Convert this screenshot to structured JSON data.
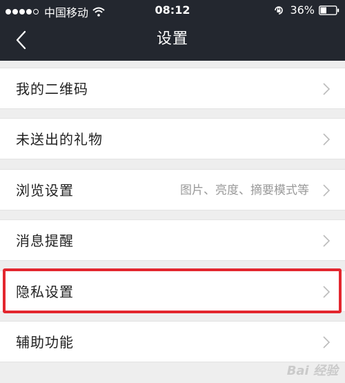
{
  "status_bar": {
    "carrier": "中国移动",
    "time": "08:12",
    "battery": "36%"
  },
  "nav": {
    "title": "设置",
    "back_icon": "chevron-left-icon"
  },
  "settings": [
    {
      "label": "我的二维码",
      "detail": ""
    },
    {
      "label": "未送出的礼物",
      "detail": ""
    },
    {
      "label": "浏览设置",
      "detail": "图片、亮度、摘要模式等"
    },
    {
      "label": "消息提醒",
      "detail": ""
    },
    {
      "label": "隐私设置",
      "detail": "",
      "highlighted": true
    },
    {
      "label": "辅助功能",
      "detail": ""
    }
  ],
  "watermark": "Bai 经验",
  "colors": {
    "header_bg": "#23272f",
    "page_bg": "#eeeeee",
    "highlight": "#e3262e"
  }
}
